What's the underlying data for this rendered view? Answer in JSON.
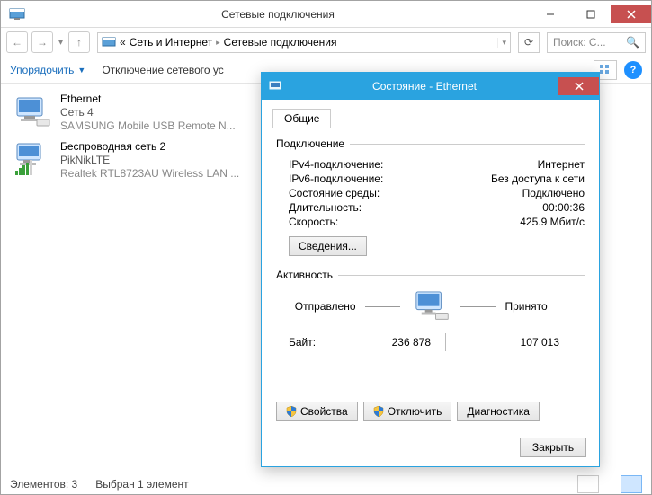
{
  "window": {
    "title": "Сетевые подключения",
    "breadcrumbs": {
      "prefix": "«",
      "a": "Сеть и Интернет",
      "b": "Сетевые подключения"
    },
    "search_placeholder": "Поиск: С...",
    "toolbar": {
      "organize": "Упорядочить",
      "disable": "Отключение сетевого ус"
    }
  },
  "connections": [
    {
      "name": "Ethernet",
      "network": "Сеть  4",
      "device": "SAMSUNG Mobile USB Remote N..."
    },
    {
      "name": "Беспроводная сеть 2",
      "network": "PikNikLTE",
      "device": "Realtek RTL8723AU Wireless LAN ..."
    }
  ],
  "status": {
    "elements": "Элементов: 3",
    "selected": "Выбран 1 элемент"
  },
  "dialog": {
    "title": "Состояние - Ethernet",
    "tab": "Общие",
    "group_conn": "Подключение",
    "kv": {
      "ipv4_k": "IPv4-подключение:",
      "ipv4_v": "Интернет",
      "ipv6_k": "IPv6-подключение:",
      "ipv6_v": "Без доступа к сети",
      "media_k": "Состояние среды:",
      "media_v": "Подключено",
      "dur_k": "Длительность:",
      "dur_v": "00:00:36",
      "speed_k": "Скорость:",
      "speed_v": "425.9 Мбит/с"
    },
    "details_btn": "Сведения...",
    "group_act": "Активность",
    "sent": "Отправлено",
    "recv": "Принято",
    "bytes_label": "Байт:",
    "bytes_sent": "236 878",
    "bytes_recv": "107 013",
    "btn_props": "Свойства",
    "btn_disable": "Отключить",
    "btn_diag": "Диагностика",
    "btn_close": "Закрыть"
  }
}
